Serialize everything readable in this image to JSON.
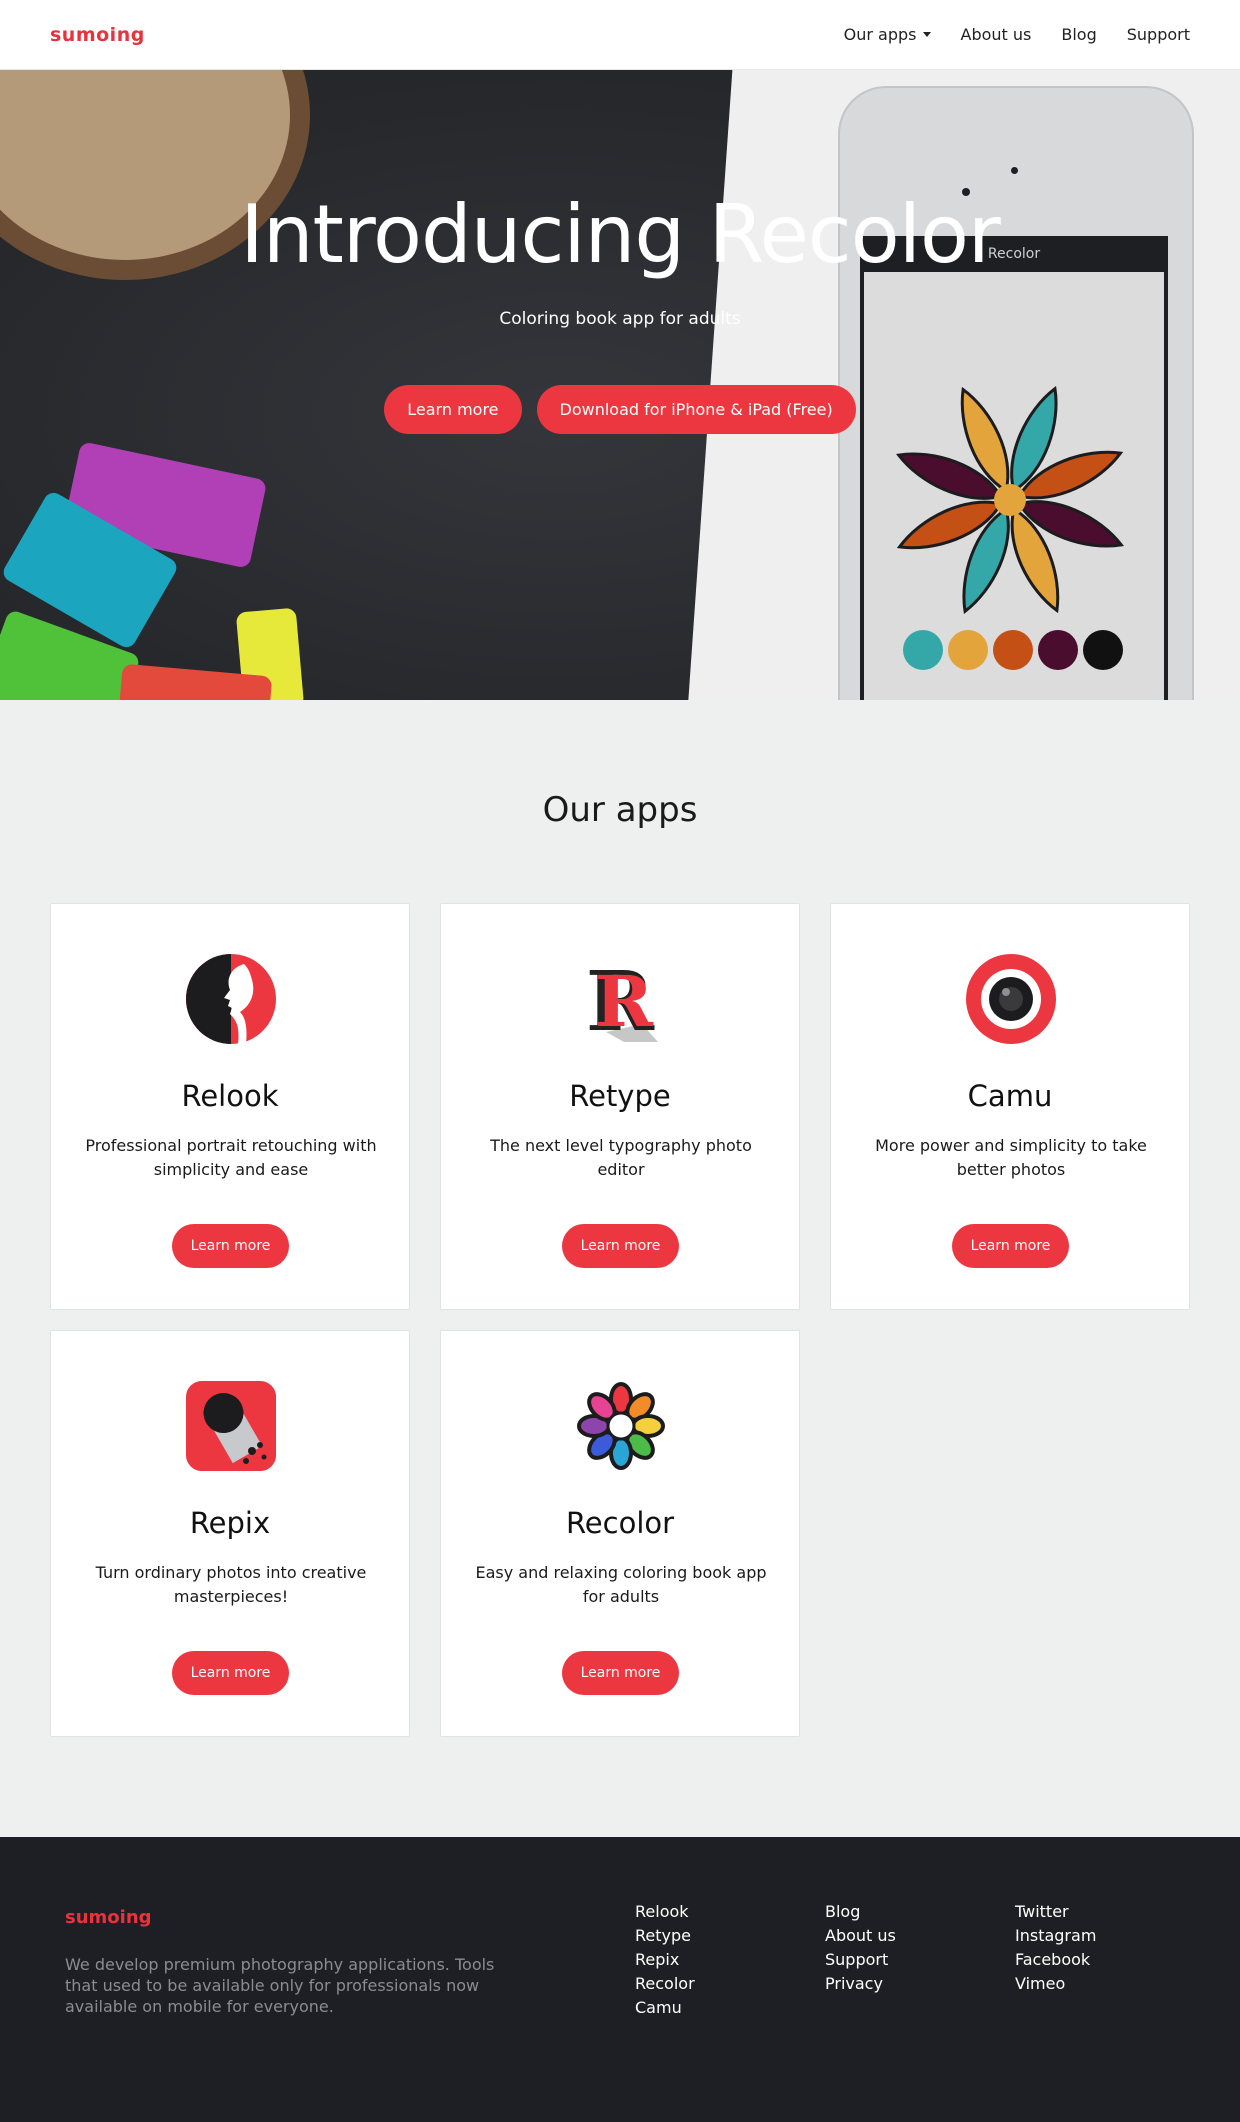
{
  "nav": {
    "logo": "sumoing",
    "links": [
      "Our apps",
      "About us",
      "Blog",
      "Support"
    ]
  },
  "hero": {
    "title": "Introducing Recolor",
    "subtitle": "Coloring book app for adults",
    "learn_more": "Learn more",
    "download": "Download for iPhone & iPad (Free)",
    "phone_title": "Recolor",
    "swatch_colors": [
      "#34a8a8",
      "#e3a43b",
      "#c55016",
      "#4a0d2e",
      "#111111"
    ]
  },
  "apps": {
    "title": "Our apps",
    "items": [
      {
        "name": "Relook",
        "desc": "Professional portrait retouching with simplicity and ease",
        "button": "Learn more",
        "icon": "relook-icon"
      },
      {
        "name": "Retype",
        "desc": "The next level typography photo editor",
        "button": "Learn more",
        "icon": "retype-icon"
      },
      {
        "name": "Camu",
        "desc": "More power and simplicity to take better photos",
        "button": "Learn more",
        "icon": "camu-icon"
      },
      {
        "name": "Repix",
        "desc": "Turn ordinary photos into creative masterpieces!",
        "button": "Learn more",
        "icon": "repix-icon"
      },
      {
        "name": "Recolor",
        "desc": "Easy and relaxing coloring book app for adults",
        "button": "Learn more",
        "icon": "recolor-icon"
      }
    ]
  },
  "footer": {
    "logo": "sumoing",
    "desc": "We develop premium photography applications. Tools that used to be available only for professionals now available on mobile for everyone.",
    "col1": [
      "Relook",
      "Retype",
      "Repix",
      "Recolor",
      "Camu"
    ],
    "col2": [
      "Blog",
      "About us",
      "Support",
      "Privacy"
    ],
    "col3": [
      "Twitter",
      "Instagram",
      "Facebook",
      "Vimeo"
    ]
  },
  "colors": {
    "accent": "#ec3740",
    "footer_bg": "#1e1f24",
    "page_bg": "#eef0ef"
  }
}
